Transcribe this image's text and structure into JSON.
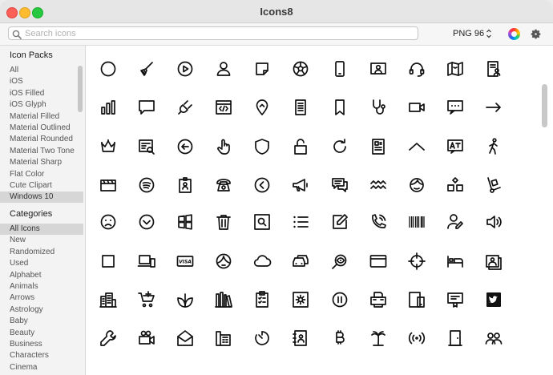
{
  "window": {
    "title": "Icons8"
  },
  "toolbar": {
    "search_placeholder": "Search icons",
    "search_value": "",
    "format_label": "PNG 96",
    "icons": {
      "search": "magnifier-icon",
      "format": "up-down-chevron-icon",
      "color": "color-wheel-icon",
      "settings": "gear-icon"
    }
  },
  "sidebar": {
    "icon_packs_title": "Icon Packs",
    "icon_packs": [
      "All",
      "iOS",
      "iOS Filled",
      "iOS Glyph",
      "Material Filled",
      "Material Outlined",
      "Material Rounded",
      "Material Two Tone",
      "Material Sharp",
      "Flat Color",
      "Cute Clipart",
      "Windows 10"
    ],
    "selected_pack": "Windows 10",
    "categories_title": "Categories",
    "categories": [
      "All Icons",
      "New",
      "Randomized",
      "Used",
      "Alphabet",
      "Animals",
      "Arrows",
      "Astrology",
      "Baby",
      "Beauty",
      "Business",
      "Characters",
      "Cinema"
    ],
    "selected_category": "All Icons"
  },
  "grid": {
    "rows": [
      [
        "circle",
        "broom",
        "play-button",
        "user",
        "sticky-note",
        "soccer-ball",
        "smartphone",
        "presentation",
        "headset",
        "map",
        "contact-list"
      ],
      [
        "bar-chart",
        "chat-bubble",
        "plug",
        "code",
        "location-pin",
        "document",
        "bookmark",
        "stethoscope",
        "video-camera",
        "message-dots",
        "right-arrow"
      ],
      [
        "crown",
        "invoice-search",
        "left-circle-arrow",
        "pointing-hand",
        "shield",
        "unlock",
        "refresh",
        "news",
        "chevron-up",
        "translate",
        "walking"
      ],
      [
        "clapperboard",
        "spotify",
        "badge",
        "telephone",
        "back-circle",
        "megaphone",
        "chat-messages",
        "zigzag",
        "customer-support",
        "modules",
        "hand-truck"
      ],
      [
        "sad-face",
        "chevron-down-circle",
        "windows-logo",
        "trash",
        "search-in-box",
        "bulleted-list",
        "edit",
        "phone-ringing",
        "barcode",
        "user-edit",
        "volume"
      ],
      [
        "square",
        "laptop-phone",
        "visa",
        "woman-face",
        "cloud",
        "cars",
        "eye-search",
        "credit-card",
        "crosshair",
        "bed",
        "photo-gallery"
      ],
      [
        "city-buildings",
        "add-to-cart",
        "leaves",
        "library-books",
        "clipboard-checklist",
        "settings-box",
        "pause-circle",
        "fax",
        "mobile-tablet",
        "certificate",
        "twitter"
      ],
      [
        "wrench",
        "camera-video",
        "open-envelope",
        "fax-phone",
        "timer",
        "contacts-book",
        "bitcoin",
        "palm-tree",
        "wireless-signal",
        "door",
        "group"
      ]
    ]
  }
}
